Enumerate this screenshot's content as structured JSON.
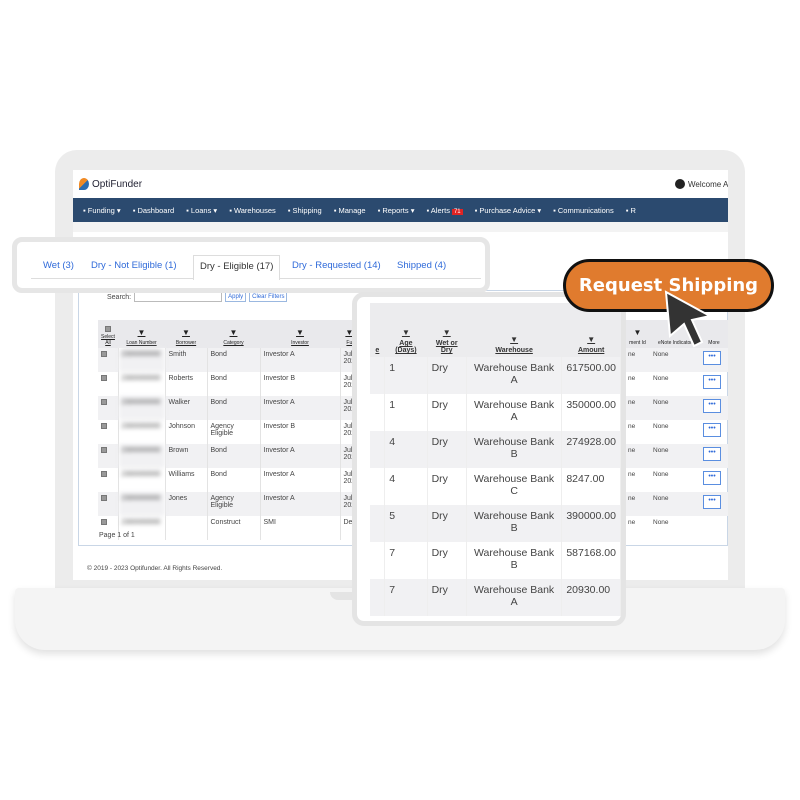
{
  "brand": {
    "name": "OptiFunder",
    "welcome": "Welcome A"
  },
  "nav": [
    {
      "label": "Funding ▾",
      "icon": "grid-icon"
    },
    {
      "label": "Dashboard",
      "icon": "bar-chart-icon"
    },
    {
      "label": "Loans ▾",
      "icon": "inbox-icon"
    },
    {
      "label": "Warehouses",
      "icon": "bank-icon"
    },
    {
      "label": "Shipping",
      "icon": "send-icon"
    },
    {
      "label": "Manage",
      "icon": "gear-icon"
    },
    {
      "label": "Reports ▾",
      "icon": "clipboard-icon"
    },
    {
      "label": "Alerts",
      "icon": "fire-icon",
      "badge": "71"
    },
    {
      "label": "Purchase Advice ▾",
      "icon": "check-circle-icon"
    },
    {
      "label": "Communications",
      "icon": "clipboard-icon"
    },
    {
      "label": "R",
      "icon": "chart-icon"
    }
  ],
  "search": {
    "label": "Search:",
    "value": "",
    "apply": "Apply",
    "clear": "Clear Filters"
  },
  "left_table": {
    "headers": [
      "Select All",
      "Loan Number",
      "Borrower",
      "Category",
      "Investor",
      "Fu"
    ],
    "rows": [
      [
        "2300000000",
        "Smith",
        "Bond",
        "Investor A",
        "Jul 202"
      ],
      [
        "2300000000",
        "Roberts",
        "Bond",
        "Investor B",
        "Jul 202"
      ],
      [
        "2300000000",
        "Walker",
        "Bond",
        "Investor A",
        "Jul 202"
      ],
      [
        "2300000000",
        "Johnson",
        "Agency Eligible",
        "Investor B",
        "Jul 202"
      ],
      [
        "2300000000",
        "Brown",
        "Bond",
        "Investor A",
        "Jul 202"
      ],
      [
        "2300000000",
        "Williams",
        "Bond",
        "Investor A",
        "Jul 202"
      ],
      [
        "2300000000",
        "Jones",
        "Agency Eligible",
        "Investor A",
        "Jul 202"
      ],
      [
        "2300000000",
        "",
        "Construct",
        "SMI",
        "De"
      ]
    ]
  },
  "right_table": {
    "headers": [
      "ment Id",
      "eNote Indicator",
      "More"
    ],
    "rows": [
      [
        "ne",
        "None",
        "•••"
      ],
      [
        "ne",
        "None",
        "•••"
      ],
      [
        "ne",
        "None",
        "•••"
      ],
      [
        "ne",
        "None",
        "•••"
      ],
      [
        "ne",
        "None",
        "•••"
      ],
      [
        "ne",
        "None",
        "•••"
      ],
      [
        "ne",
        "None",
        "•••"
      ],
      [
        "ne",
        "None",
        ""
      ]
    ]
  },
  "pager": "Page 1 of 1",
  "copyright": "© 2019 - 2023 Optifunder. All Rights Reserved.",
  "tabs": [
    {
      "label": "Wet (3)"
    },
    {
      "label": "Dry - Not Eligible (1)"
    },
    {
      "label": "Dry - Eligible  (17)",
      "active": true
    },
    {
      "label": "Dry - Requested (14)"
    },
    {
      "label": "Shipped (4)"
    }
  ],
  "overlay_table": {
    "headers": [
      "e",
      "Age (Days)",
      "Wet or Dry",
      "Warehouse",
      "Amount"
    ],
    "rows": [
      [
        "",
        "1",
        "Dry",
        "Warehouse Bank A",
        "617500.00"
      ],
      [
        "",
        "1",
        "Dry",
        "Warehouse Bank A",
        "350000.00"
      ],
      [
        "",
        "4",
        "Dry",
        "Warehouse Bank B",
        "274928.00"
      ],
      [
        "",
        "4",
        "Dry",
        "Warehouse Bank C",
        "8247.00"
      ],
      [
        "",
        "5",
        "Dry",
        "Warehouse Bank B",
        "390000.00"
      ],
      [
        "",
        "7",
        "Dry",
        "Warehouse Bank B",
        "587168.00"
      ],
      [
        "",
        "7",
        "Dry",
        "Warehouse Bank A",
        "20930.00"
      ]
    ]
  },
  "cta": {
    "label": "Request Shipping",
    "color": "#e07b2e"
  },
  "colors": {
    "nav": "#2b4a6f",
    "link": "#2f6ad9"
  }
}
